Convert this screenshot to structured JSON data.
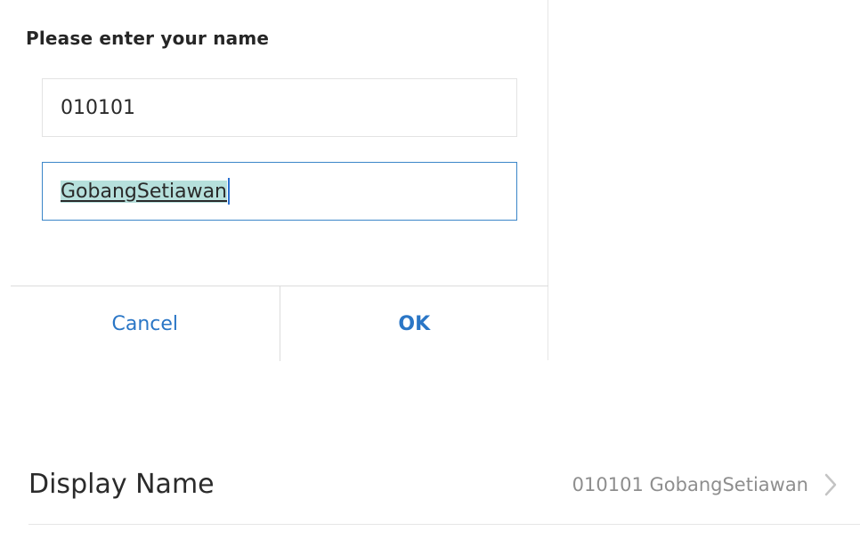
{
  "dialog": {
    "title": "Please enter your name",
    "first_field": {
      "value": "010101"
    },
    "second_field": {
      "value": "GobangSetiawan"
    },
    "cancel_label": "Cancel",
    "ok_label": "OK"
  },
  "settings": {
    "display_name": {
      "label": "Display Name",
      "value": "010101 GobangSetiawan",
      "chevron_icon": "chevron-right-icon"
    }
  },
  "colors": {
    "accent": "#2a76c6",
    "focus_border": "#3b86c8",
    "selection": "#b6e0dc"
  }
}
